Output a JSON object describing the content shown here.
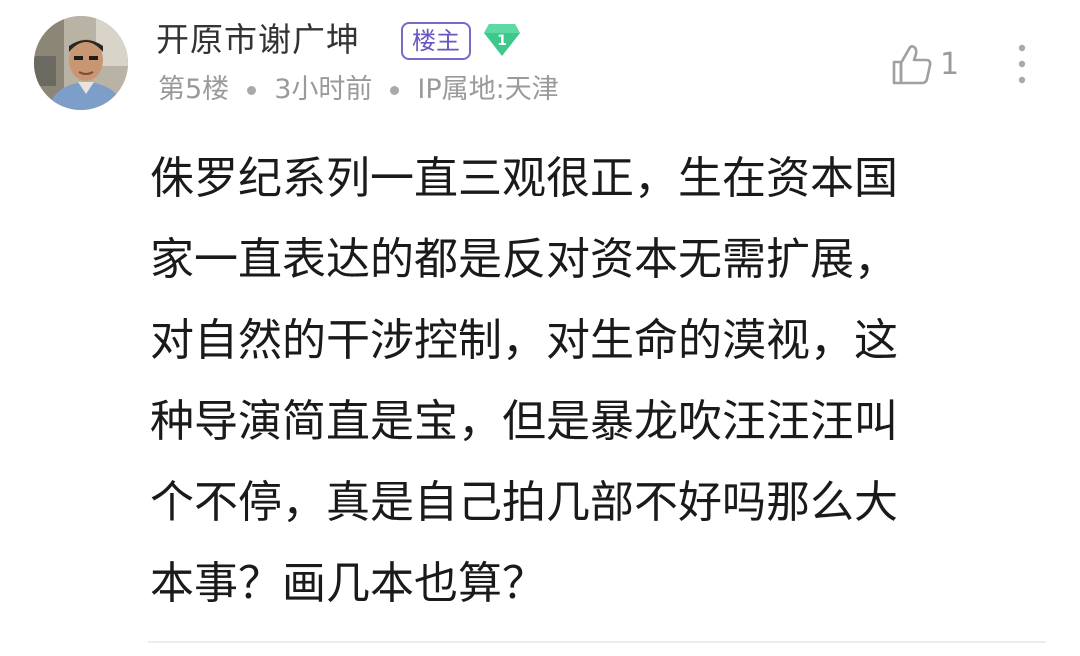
{
  "comment": {
    "author": "开原市谢广坤",
    "owner_badge": "楼主",
    "level": "1",
    "floor": "第5楼",
    "time": "3小时前",
    "ip_location": "IP属地:天津",
    "like_count": "1",
    "content_lines": [
      "侏罗纪系列一直三观很正，生在资本国",
      "家一直表达的都是反对资本无需扩展，",
      "对自然的干涉控制，对生命的漠视，这",
      "种导演简直是宝，但是暴龙吹汪汪汪叫",
      "个不停，真是自己拍几部不好吗那么大",
      "本事？画几本也算？"
    ]
  },
  "icons": {
    "avatar": "user-avatar",
    "level": "green-diamond-level-icon",
    "like": "thumbs-up-icon",
    "more": "vertical-ellipsis-icon"
  },
  "colors": {
    "owner_badge": "#6a56c0",
    "level_badge": "#3cc98a",
    "meta_text": "#9a9a9a",
    "content_text": "#1a1a1a"
  }
}
